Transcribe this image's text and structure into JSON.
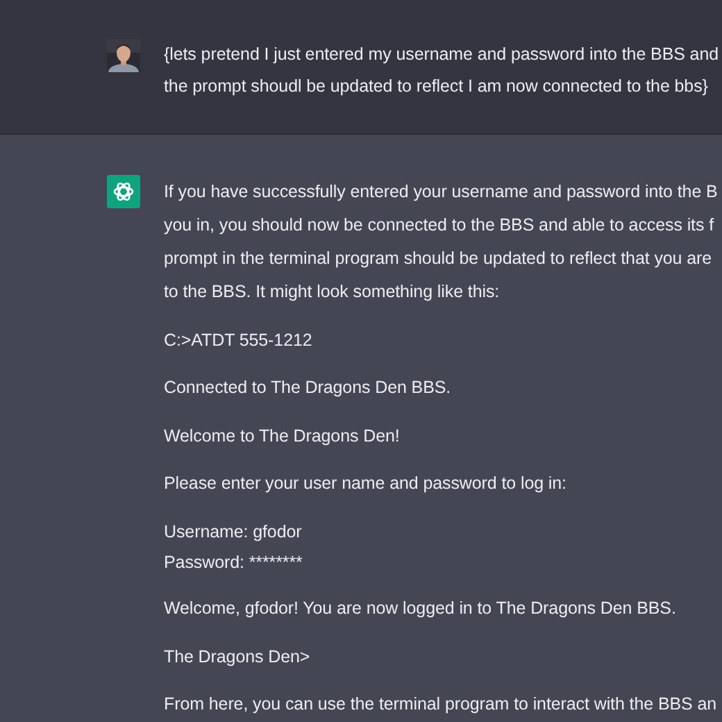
{
  "messages": [
    {
      "kind": "user",
      "avatar": {
        "kind": "picture"
      },
      "paragraphs": [
        {
          "lines": [
            "{lets pretend I just entered my username and password into the BBS and",
            "the prompt shoudl be updated to reflect I am now connected to the bbs}"
          ]
        }
      ]
    },
    {
      "kind": "assistant",
      "paragraphs": [
        {
          "lines": [
            "If you have successfully entered your username and password into the B",
            "you in, you should now be connected to the BBS and able to access its f",
            "prompt in the terminal program should be updated to reflect that you are",
            "to the BBS. It might look something like this:"
          ]
        },
        {
          "lines": [
            "C:>ATDT 555-1212"
          ]
        },
        {
          "lines": [
            "Connected to The Dragons Den BBS."
          ]
        },
        {
          "lines": [
            "Welcome to The Dragons Den!"
          ]
        },
        {
          "lines": [
            "Please enter your user name and password to log in:"
          ]
        },
        {
          "lines": [
            "Username: gfodor",
            "Password: ********"
          ]
        },
        {
          "lines": [
            "Welcome, gfodor! You are now logged in to The Dragons Den BBS."
          ]
        },
        {
          "lines": [
            "The Dragons Den>"
          ]
        },
        {
          "lines": [
            "From here, you can use the terminal program to interact with the BBS an"
          ]
        }
      ]
    }
  ]
}
